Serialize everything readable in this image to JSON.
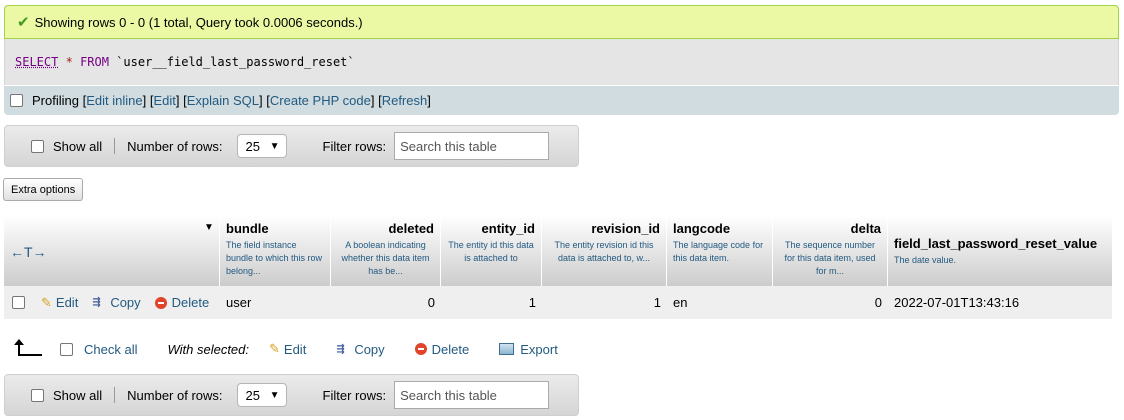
{
  "success": {
    "icon": "check-icon",
    "message": "Showing rows 0 - 0 (1 total, Query took 0.0006 seconds.)",
    "color": "#ebf8a4"
  },
  "sql": {
    "select": "SELECT",
    "star": "*",
    "from": "FROM",
    "table": "`user__field_last_password_reset`"
  },
  "profiling": {
    "label": "Profiling",
    "open": "[",
    "close": "]",
    "links": [
      "Edit inline",
      "Edit",
      "Explain SQL",
      "Create PHP code",
      "Refresh"
    ]
  },
  "nav": {
    "show_all": "Show all",
    "rows_label": "Number of rows:",
    "rows_value": "25",
    "filter_label": "Filter rows:",
    "filter_placeholder": "Search this table"
  },
  "extra_options": "Extra options",
  "table": {
    "arrows": "←T→",
    "columns": [
      {
        "name": "bundle",
        "comment": "The field instance bundle to which this row belong..."
      },
      {
        "name": "deleted",
        "comment": "A boolean indicating whether this data item has be..."
      },
      {
        "name": "entity_id",
        "comment": "The entity id this data is attached to"
      },
      {
        "name": "revision_id",
        "comment": "The entity revision id this data is attached to, w..."
      },
      {
        "name": "langcode",
        "comment": "The language code for this data item."
      },
      {
        "name": "delta",
        "comment": "The sequence number for this data item, used for m..."
      },
      {
        "name": "field_last_password_reset_value",
        "comment": "The date value."
      }
    ],
    "row_actions": {
      "edit": "Edit",
      "copy": "Copy",
      "delete": "Delete"
    },
    "rows": [
      {
        "bundle": "user",
        "deleted": "0",
        "entity_id": "1",
        "revision_id": "1",
        "langcode": "en",
        "delta": "0",
        "value": "2022-07-01T13:43:16"
      }
    ]
  },
  "bulk": {
    "check_all": "Check all",
    "with_selected": "With selected:",
    "edit": "Edit",
    "copy": "Copy",
    "delete": "Delete",
    "export": "Export"
  }
}
